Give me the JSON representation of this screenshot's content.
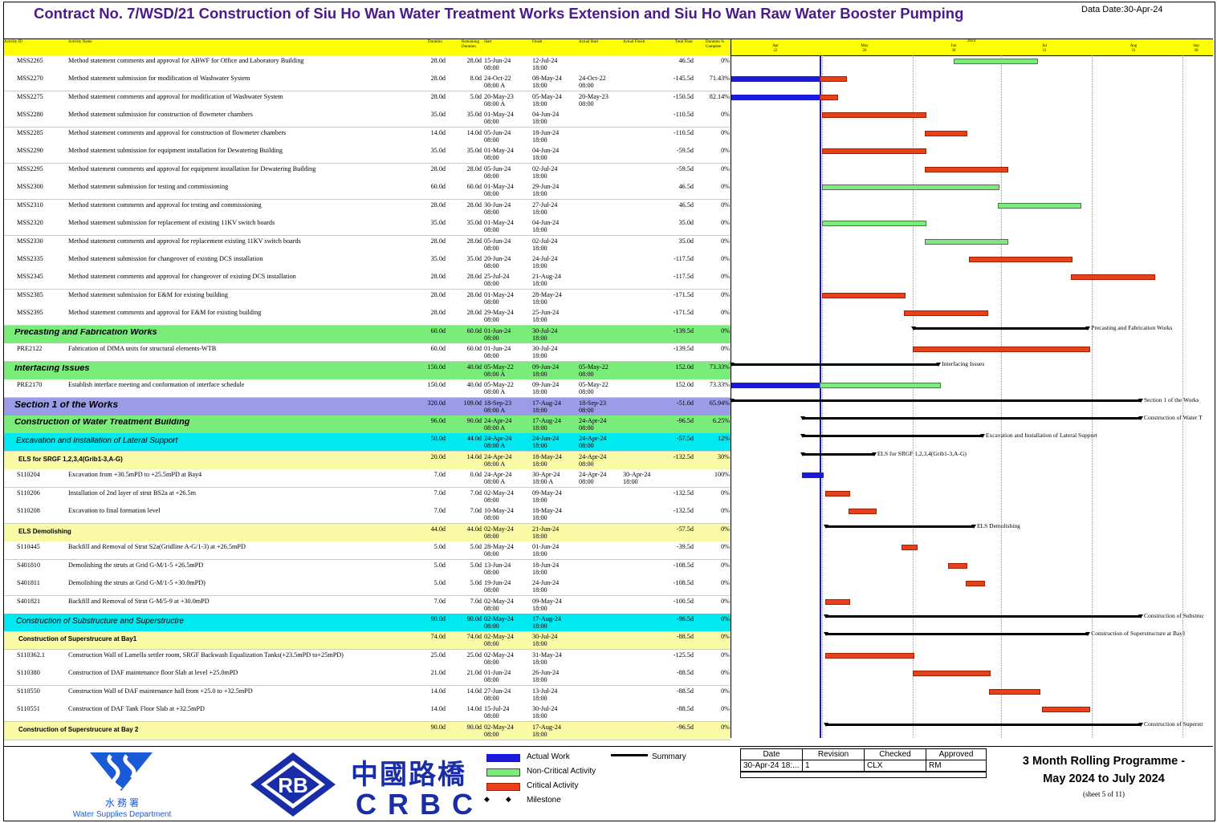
{
  "header": {
    "title": "Contract No. 7/WSD/21 Construction of Siu Ho Wan Water Treatment Works Extension and Siu Ho Wan Raw Water Booster Pumping",
    "data_date": "Data Date:30-Apr-24"
  },
  "columns": {
    "id": "Activity ID",
    "name": "Activity Name",
    "od": "Duration",
    "rd": "Remaining Duration",
    "start": "Start",
    "finish": "Finish",
    "astart": "Actual Start",
    "afinish": "Actual Finish",
    "tf": "Total Float",
    "pct": "Duration % Complete"
  },
  "timeline": {
    "year": "2024",
    "months": [
      "Apr",
      "May",
      "Jun",
      "Jul",
      "Aug",
      "Sep"
    ],
    "days": [
      "22",
      "26",
      "30",
      "31",
      "31",
      "30"
    ]
  },
  "rows": [
    {
      "type": "act",
      "id": "MSS2265",
      "name": "Method statement comments and approval for ABWF for Office and Laboratory Building",
      "od": "28.0d",
      "rd": "28.0d",
      "s1": "15-Jun-24",
      "s2": "08:00",
      "f1": "12-Jul-24",
      "f2": "18:00",
      "as1": "",
      "as2": "",
      "af1": "",
      "af2": "",
      "tf": "46.5d",
      "pct": "0%"
    },
    {
      "type": "act",
      "id": "MSS2270",
      "name": "Method statement submission for modification of Washwater System",
      "od": "28.0d",
      "rd": "8.0d",
      "s1": "24-Oct-22",
      "s2": "08:00 A",
      "f1": "08-May-24",
      "f2": "18:00",
      "as1": "24-Oct-22",
      "as2": "08:00",
      "af1": "",
      "af2": "",
      "tf": "-145.5d",
      "pct": "71.43%"
    },
    {
      "type": "act",
      "id": "MSS2275",
      "name": "Method statement comments and approval for modification of Washwater System",
      "od": "28.0d",
      "rd": "5.0d",
      "s1": "20-May-23",
      "s2": "08:00 A",
      "f1": "05-May-24",
      "f2": "18:00",
      "as1": "20-May-23",
      "as2": "08:00",
      "af1": "",
      "af2": "",
      "tf": "-150.5d",
      "pct": "82.14%"
    },
    {
      "type": "act",
      "id": "MSS2280",
      "name": "Method statement submission for construction of flowmeter chambers",
      "od": "35.0d",
      "rd": "35.0d",
      "s1": "01-May-24",
      "s2": "08:00",
      "f1": "04-Jun-24",
      "f2": "18:00",
      "as1": "",
      "as2": "",
      "af1": "",
      "af2": "",
      "tf": "-110.5d",
      "pct": "0%"
    },
    {
      "type": "act",
      "id": "MSS2285",
      "name": "Method statement comments and approval for construction of flowmeter chambers",
      "od": "14.0d",
      "rd": "14.0d",
      "s1": "05-Jun-24",
      "s2": "08:00",
      "f1": "18-Jun-24",
      "f2": "18:00",
      "as1": "",
      "as2": "",
      "af1": "",
      "af2": "",
      "tf": "-110.5d",
      "pct": "0%"
    },
    {
      "type": "act",
      "id": "MSS2290",
      "name": "Method statement submission for equipment installation for Dewatering Building",
      "od": "35.0d",
      "rd": "35.0d",
      "s1": "01-May-24",
      "s2": "08:00",
      "f1": "04-Jun-24",
      "f2": "18:00",
      "as1": "",
      "as2": "",
      "af1": "",
      "af2": "",
      "tf": "-59.5d",
      "pct": "0%"
    },
    {
      "type": "act",
      "id": "MSS2295",
      "name": "Method statement comments and approval for equipment installation for Dewatering Building",
      "od": "28.0d",
      "rd": "28.0d",
      "s1": "05-Jun-24",
      "s2": "08:00",
      "f1": "02-Jul-24",
      "f2": "18:00",
      "as1": "",
      "as2": "",
      "af1": "",
      "af2": "",
      "tf": "-59.5d",
      "pct": "0%"
    },
    {
      "type": "act",
      "id": "MSS2300",
      "name": "Method statement submission for testing and commissioning",
      "od": "60.0d",
      "rd": "60.0d",
      "s1": "01-May-24",
      "s2": "08:00",
      "f1": "29-Jun-24",
      "f2": "18:00",
      "as1": "",
      "as2": "",
      "af1": "",
      "af2": "",
      "tf": "46.5d",
      "pct": "0%"
    },
    {
      "type": "act",
      "id": "MSS2310",
      "name": "Method statement comments and approval for testing and commissioning",
      "od": "28.0d",
      "rd": "28.0d",
      "s1": "30-Jun-24",
      "s2": "08:00",
      "f1": "27-Jul-24",
      "f2": "18:00",
      "as1": "",
      "as2": "",
      "af1": "",
      "af2": "",
      "tf": "46.5d",
      "pct": "0%"
    },
    {
      "type": "act",
      "id": "MSS2320",
      "name": "Method statement submission for replacement of existing 11KV switch boards",
      "od": "35.0d",
      "rd": "35.0d",
      "s1": "01-May-24",
      "s2": "08:00",
      "f1": "04-Jun-24",
      "f2": "18:00",
      "as1": "",
      "as2": "",
      "af1": "",
      "af2": "",
      "tf": "35.0d",
      "pct": "0%"
    },
    {
      "type": "act",
      "id": "MSS2330",
      "name": "Method statement comments and approval for replacement existing 11KV switch boards",
      "od": "28.0d",
      "rd": "28.0d",
      "s1": "05-Jun-24",
      "s2": "08:00",
      "f1": "02-Jul-24",
      "f2": "18:00",
      "as1": "",
      "as2": "",
      "af1": "",
      "af2": "",
      "tf": "35.0d",
      "pct": "0%"
    },
    {
      "type": "act",
      "id": "MSS2335",
      "name": "Method statement submission for changeover of existing DCS installation",
      "od": "35.0d",
      "rd": "35.0d",
      "s1": "20-Jun-24",
      "s2": "08:00",
      "f1": "24-Jul-24",
      "f2": "18:00",
      "as1": "",
      "as2": "",
      "af1": "",
      "af2": "",
      "tf": "-117.5d",
      "pct": "0%"
    },
    {
      "type": "act",
      "id": "MSS2345",
      "name": "Method statement comments and approval for changeover of existing DCS installation",
      "od": "28.0d",
      "rd": "28.0d",
      "s1": "25-Jul-24",
      "s2": "08:00",
      "f1": "21-Aug-24",
      "f2": "18:00",
      "as1": "",
      "as2": "",
      "af1": "",
      "af2": "",
      "tf": "-117.5d",
      "pct": "0%"
    },
    {
      "type": "act",
      "id": "MSS2385",
      "name": "Method statement submission for E&M for existing building",
      "od": "28.0d",
      "rd": "28.0d",
      "s1": "01-May-24",
      "s2": "08:00",
      "f1": "28-May-24",
      "f2": "18:00",
      "as1": "",
      "as2": "",
      "af1": "",
      "af2": "",
      "tf": "-171.5d",
      "pct": "0%"
    },
    {
      "type": "act",
      "id": "MSS2395",
      "name": "Method statement comments and approval for E&M for existing building",
      "od": "28.0d",
      "rd": "28.0d",
      "s1": "29-May-24",
      "s2": "08:00",
      "f1": "25-Jun-24",
      "f2": "18:00",
      "as1": "",
      "as2": "",
      "af1": "",
      "af2": "",
      "tf": "-171.5d",
      "pct": "0%"
    },
    {
      "type": "lvl1",
      "id": "",
      "name": "Precasting and Fabrication Works",
      "od": "60.0d",
      "rd": "60.0d",
      "s1": "01-Jun-24",
      "s2": "08:00",
      "f1": "30-Jul-24",
      "f2": "18:00",
      "as1": "",
      "as2": "",
      "af1": "",
      "af2": "",
      "tf": "-139.5d",
      "pct": "0%"
    },
    {
      "type": "act",
      "id": "PRE2122",
      "name": "Fabrication of DfMA units for structural elements-WTB",
      "od": "60.0d",
      "rd": "60.0d",
      "s1": "01-Jun-24",
      "s2": "08:00",
      "f1": "30-Jul-24",
      "f2": "18:00",
      "as1": "",
      "as2": "",
      "af1": "",
      "af2": "",
      "tf": "-139.5d",
      "pct": "0%"
    },
    {
      "type": "lvl1",
      "id": "",
      "name": "Interfacing Issues",
      "od": "150.0d",
      "rd": "40.0d",
      "s1": "05-May-22",
      "s2": "08:00 A",
      "f1": "09-Jun-24",
      "f2": "18:00",
      "as1": "05-May-22",
      "as2": "08:00",
      "af1": "",
      "af2": "",
      "tf": "152.0d",
      "pct": "73.33%"
    },
    {
      "type": "act",
      "id": "PRE2170",
      "name": "Establish interface meeting and conformation of interface schedule",
      "od": "150.0d",
      "rd": "40.0d",
      "s1": "05-May-22",
      "s2": "08:00 A",
      "f1": "09-Jun-24",
      "f2": "18:00",
      "as1": "05-May-22",
      "as2": "08:00",
      "af1": "",
      "af2": "",
      "tf": "152.0d",
      "pct": "73.33%"
    },
    {
      "type": "sec",
      "id": "",
      "name": "Section 1 of the Works",
      "od": "320.0d",
      "rd": "109.0d",
      "s1": "18-Sep-23",
      "s2": "08:00 A",
      "f1": "17-Aug-24",
      "f2": "18:00",
      "as1": "18-Sep-23",
      "as2": "08:00",
      "af1": "",
      "af2": "",
      "tf": "-51.0d",
      "pct": "65.94%"
    },
    {
      "type": "lvl2",
      "id": "",
      "name": "Construction of Water Treatment Building",
      "od": "96.0d",
      "rd": "90.0d",
      "s1": "24-Apr-24",
      "s2": "08:00 A",
      "f1": "17-Aug-24",
      "f2": "18:00",
      "as1": "24-Apr-24",
      "as2": "08:00",
      "af1": "",
      "af2": "",
      "tf": "-96.5d",
      "pct": "6.25%"
    },
    {
      "type": "lvl3",
      "id": "",
      "name": "Excavation and Installation of Lateral Support",
      "od": "50.0d",
      "rd": "44.0d",
      "s1": "24-Apr-24",
      "s2": "08:00 A",
      "f1": "24-Jun-24",
      "f2": "18:00",
      "as1": "24-Apr-24",
      "as2": "08:00",
      "af1": "",
      "af2": "",
      "tf": "-57.5d",
      "pct": "12%"
    },
    {
      "type": "lvl4",
      "id": "",
      "name": "ELS for SRGF 1,2,3,4(Grib1-3,A-G)",
      "od": "20.0d",
      "rd": "14.0d",
      "s1": "24-Apr-24",
      "s2": "08:00 A",
      "f1": "18-May-24",
      "f2": "18:00",
      "as1": "24-Apr-24",
      "as2": "08:00",
      "af1": "",
      "af2": "",
      "tf": "-132.5d",
      "pct": "30%"
    },
    {
      "type": "act",
      "id": "S110204",
      "name": "Excavation from +30.5mPD to +25.5mPD at Bay4",
      "od": "7.0d",
      "rd": "0.0d",
      "s1": "24-Apr-24",
      "s2": "08:00 A",
      "f1": "30-Apr-24",
      "f2": "18:00 A",
      "as1": "24-Apr-24",
      "as2": "08:00",
      "af1": "30-Apr-24",
      "af2": "18:00",
      "tf": "",
      "pct": "100%"
    },
    {
      "type": "act",
      "id": "S110206",
      "name": "Installation of 2nd layer of strut BS2a at +26.5m",
      "od": "7.0d",
      "rd": "7.0d",
      "s1": "02-May-24",
      "s2": "08:00",
      "f1": "09-May-24",
      "f2": "18:00",
      "as1": "",
      "as2": "",
      "af1": "",
      "af2": "",
      "tf": "-132.5d",
      "pct": "0%"
    },
    {
      "type": "act",
      "id": "S110208",
      "name": "Excavation to final formation level",
      "od": "7.0d",
      "rd": "7.0d",
      "s1": "10-May-24",
      "s2": "08:00",
      "f1": "18-May-24",
      "f2": "18:00",
      "as1": "",
      "as2": "",
      "af1": "",
      "af2": "",
      "tf": "-132.5d",
      "pct": "0%"
    },
    {
      "type": "lvl4",
      "id": "",
      "name": "ELS Demolishing",
      "od": "44.0d",
      "rd": "44.0d",
      "s1": "02-May-24",
      "s2": "08:00",
      "f1": "21-Jun-24",
      "f2": "18:00",
      "as1": "",
      "as2": "",
      "af1": "",
      "af2": "",
      "tf": "-57.5d",
      "pct": "0%"
    },
    {
      "type": "act",
      "id": "S110445",
      "name": "Backfill and Removal of Strut S2a(Gridline A-G/1-3) at +26.5mPD",
      "od": "5.0d",
      "rd": "5.0d",
      "s1": "28-May-24",
      "s2": "08:00",
      "f1": "01-Jun-24",
      "f2": "18:00",
      "as1": "",
      "as2": "",
      "af1": "",
      "af2": "",
      "tf": "-39.5d",
      "pct": "0%"
    },
    {
      "type": "act",
      "id": "S401810",
      "name": "Demolishing the struts at  Grid  G-M/1-5 +26.5mPD",
      "od": "5.0d",
      "rd": "5.0d",
      "s1": "13-Jun-24",
      "s2": "08:00",
      "f1": "18-Jun-24",
      "f2": "18:00",
      "as1": "",
      "as2": "",
      "af1": "",
      "af2": "",
      "tf": "-108.5d",
      "pct": "0%"
    },
    {
      "type": "act",
      "id": "S401811",
      "name": "Demolishing the struts at  Grid  G-M/1-5 +30.0mPD)",
      "od": "5.0d",
      "rd": "5.0d",
      "s1": "19-Jun-24",
      "s2": "08:00",
      "f1": "24-Jun-24",
      "f2": "18:00",
      "as1": "",
      "as2": "",
      "af1": "",
      "af2": "",
      "tf": "-108.5d",
      "pct": "0%"
    },
    {
      "type": "act",
      "id": "S401821",
      "name": "Backfill and Removal of Strut G-M/5-9 at +30.0mPD",
      "od": "7.0d",
      "rd": "7.0d",
      "s1": "02-May-24",
      "s2": "08:00",
      "f1": "09-May-24",
      "f2": "18:00",
      "as1": "",
      "as2": "",
      "af1": "",
      "af2": "",
      "tf": "-100.5d",
      "pct": "0%"
    },
    {
      "type": "lvl3",
      "id": "",
      "name": "Construction of Substructure and Superstructre",
      "od": "90.0d",
      "rd": "90.0d",
      "s1": "02-May-24",
      "s2": "08:00",
      "f1": "17-Aug-24",
      "f2": "18:00",
      "as1": "",
      "as2": "",
      "af1": "",
      "af2": "",
      "tf": "-96.5d",
      "pct": "0%"
    },
    {
      "type": "lvl4",
      "id": "",
      "name": "Construction of Superstrucure at Bay1",
      "od": "74.0d",
      "rd": "74.0d",
      "s1": "02-May-24",
      "s2": "08:00",
      "f1": "30-Jul-24",
      "f2": "18:00",
      "as1": "",
      "as2": "",
      "af1": "",
      "af2": "",
      "tf": "-88.5d",
      "pct": "0%"
    },
    {
      "type": "act",
      "id": "S110362.1",
      "name": "Construction Wall of Lamella settler room, SRGF Backwash Equalization Tanks(+23.5mPD to+25mPD)",
      "od": "25.0d",
      "rd": "25.0d",
      "s1": "02-May-24",
      "s2": "08:00",
      "f1": "31-May-24",
      "f2": "18:00",
      "as1": "",
      "as2": "",
      "af1": "",
      "af2": "",
      "tf": "-125.5d",
      "pct": "0%"
    },
    {
      "type": "act",
      "id": "S110380",
      "name": "Construction of DAF maintenance floor Slab at level +25.0mPD",
      "od": "21.0d",
      "rd": "21.0d",
      "s1": "01-Jun-24",
      "s2": "08:00",
      "f1": "26-Jun-24",
      "f2": "18:00",
      "as1": "",
      "as2": "",
      "af1": "",
      "af2": "",
      "tf": "-88.5d",
      "pct": "0%"
    },
    {
      "type": "act",
      "id": "S110550",
      "name": "Construction Wall of DAF maintenance hall from +25.0 to +32.5mPD",
      "od": "14.0d",
      "rd": "14.0d",
      "s1": "27-Jun-24",
      "s2": "08:00",
      "f1": "13-Jul-24",
      "f2": "18:00",
      "as1": "",
      "as2": "",
      "af1": "",
      "af2": "",
      "tf": "-88.5d",
      "pct": "0%"
    },
    {
      "type": "act",
      "id": "S110551",
      "name": "Construction of DAF Tank Floor Slab at +32.5mPD",
      "od": "14.0d",
      "rd": "14.0d",
      "s1": "15-Jul-24",
      "s2": "08:00",
      "f1": "30-Jul-24",
      "f2": "18:00",
      "as1": "",
      "as2": "",
      "af1": "",
      "af2": "",
      "tf": "-88.5d",
      "pct": "0%"
    },
    {
      "type": "lvl4",
      "id": "",
      "name": "Construction of Superstrucure at Bay 2",
      "od": "90.0d",
      "rd": "90.0d",
      "s1": "02-May-24",
      "s2": "08:00",
      "f1": "17-Aug-24",
      "f2": "18:00",
      "as1": "",
      "as2": "",
      "af1": "",
      "af2": "",
      "tf": "-96.5d",
      "pct": "0%"
    }
  ],
  "gantt": {
    "summary_labels": {
      "prefab": "Precasting and Fabrication Works",
      "interf": "Interfacing Issues",
      "sec1": "Section 1 of the Works",
      "wtb": "Construction of Water T",
      "exc": "Excavation and Installation of Lateral Support",
      "els": "ELS for SRGF 1,2,3,4(Grib1-3,A-G)",
      "elsdem": "ELS Demolishing",
      "subs": "Construction of Substruc",
      "bay1": "Construction of Superstructure at Bay1",
      "bay2": "Construction of Superstr"
    }
  },
  "legend": {
    "actual": "Actual Work",
    "noncritical": "Non-Critical Activity",
    "critical": "Critical Activity",
    "milestone": "Milestone",
    "summary": "Summary",
    "colors": {
      "actual": "#1a1adc",
      "noncritical": "#7aec7a",
      "critical": "#e8401a"
    }
  },
  "revision": {
    "headers": [
      "Date",
      "Revision",
      "Checked",
      "Approved"
    ],
    "values": [
      "30-Apr-24 18:...",
      "1",
      "CLX",
      "RM"
    ]
  },
  "programme": {
    "line1": "3 Month Rolling Programme -",
    "line2": "May 2024 to July 2024",
    "sheet": "(sheet 5 of 11)"
  },
  "logos": {
    "wsd_cn": "水 務 署",
    "wsd_en": "Water Supplies Department",
    "rb": "RB",
    "crbc_cn": "中國路橋",
    "crbc_en": "CRBC"
  }
}
